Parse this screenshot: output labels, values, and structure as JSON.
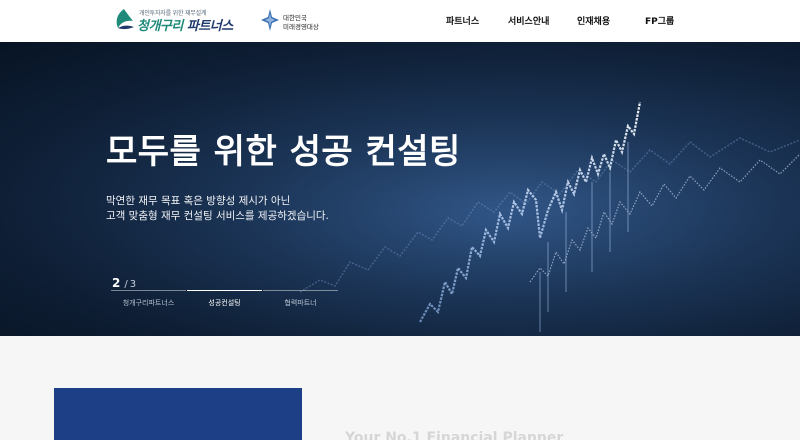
{
  "header": {
    "logo": {
      "slogan": "개인투자자를 위한 재무설계",
      "name_part1": "청개구리",
      "name_part2": " 파트너스",
      "icon": "frog-leaf-logo-icon",
      "color_green": "#1f8a7a",
      "color_navy": "#1f3a6b"
    },
    "award": {
      "line1": "대한민국",
      "line2": "미래경영대상",
      "icon": "award-emblem-icon"
    },
    "nav": [
      {
        "label": "파트너스"
      },
      {
        "label": "서비스안내"
      },
      {
        "label": "인재채용"
      },
      {
        "label": "FP그룹"
      }
    ]
  },
  "hero": {
    "title": "모두를 위한 성공 컨설팅",
    "desc_line1": "막연한 재무 목표 혹은 방향성 제시가 아닌",
    "desc_line2": "고객 맞춤형 재무 컨설팅 서비스를 제공하겠습니다.",
    "pager": {
      "current": "2",
      "separator": "/",
      "total": "3"
    },
    "indicators": [
      {
        "label": "청개구리파트너스",
        "active": false
      },
      {
        "label": "성공컨설팅",
        "active": true
      },
      {
        "label": "협력파트너",
        "active": false
      }
    ],
    "background_color": "#0d1d33"
  },
  "section": {
    "english_title": "Your No.1 Financial Planner",
    "box_color": "#1c3f86"
  }
}
